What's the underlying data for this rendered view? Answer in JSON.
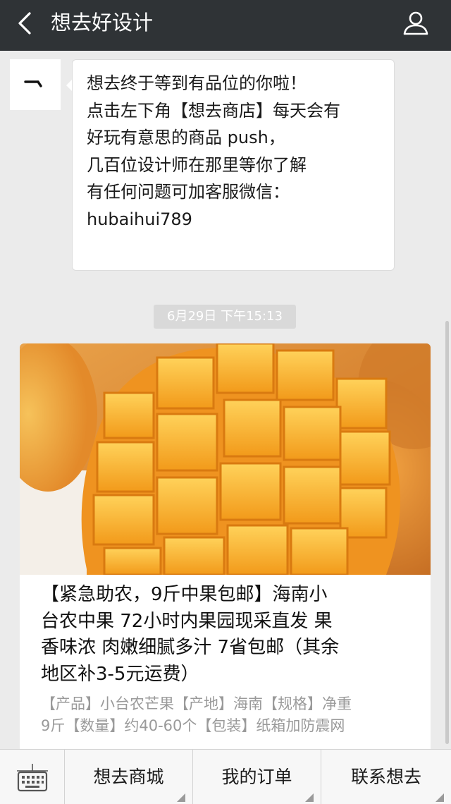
{
  "header": {
    "title": "想去好设计",
    "back_icon": "back-arrow-icon",
    "user_icon": "user-profile-icon"
  },
  "welcome_message": {
    "lines": [
      "想去终于等到有品位的你啦！",
      "点击左下角【想去商店】每天会有",
      "好玩有意思的商品 push，",
      "几百位设计师在那里等你了解",
      "有任何问题可加客服微信：",
      "hubaihui789"
    ]
  },
  "timestamp": "6月29日 下午15:13",
  "article_card": {
    "image_description_icon": "mango-photo",
    "title_lines": [
      "【紧急助农，9斤中果包邮】海南小",
      "台农中果 72小时内果园现采直发 果",
      "香味浓 肉嫩细腻多汁 7省包邮（其余",
      "地区补3-5元运费）"
    ],
    "desc_lines": [
      "【产品】小台农芒果【产地】海南【规格】净重",
      "9斤【数量】约40-60个【包装】纸箱加防震网"
    ]
  },
  "bottom_menu": {
    "keyboard_icon": "keyboard-icon",
    "items": [
      {
        "label": "想去商城"
      },
      {
        "label": "我的订单"
      },
      {
        "label": "联系想去"
      }
    ]
  },
  "colors": {
    "topbar": "#2f3336",
    "background": "#ebebeb",
    "timestamp_bg": "#d9d9d9",
    "desc_text": "#9a9a9a"
  }
}
